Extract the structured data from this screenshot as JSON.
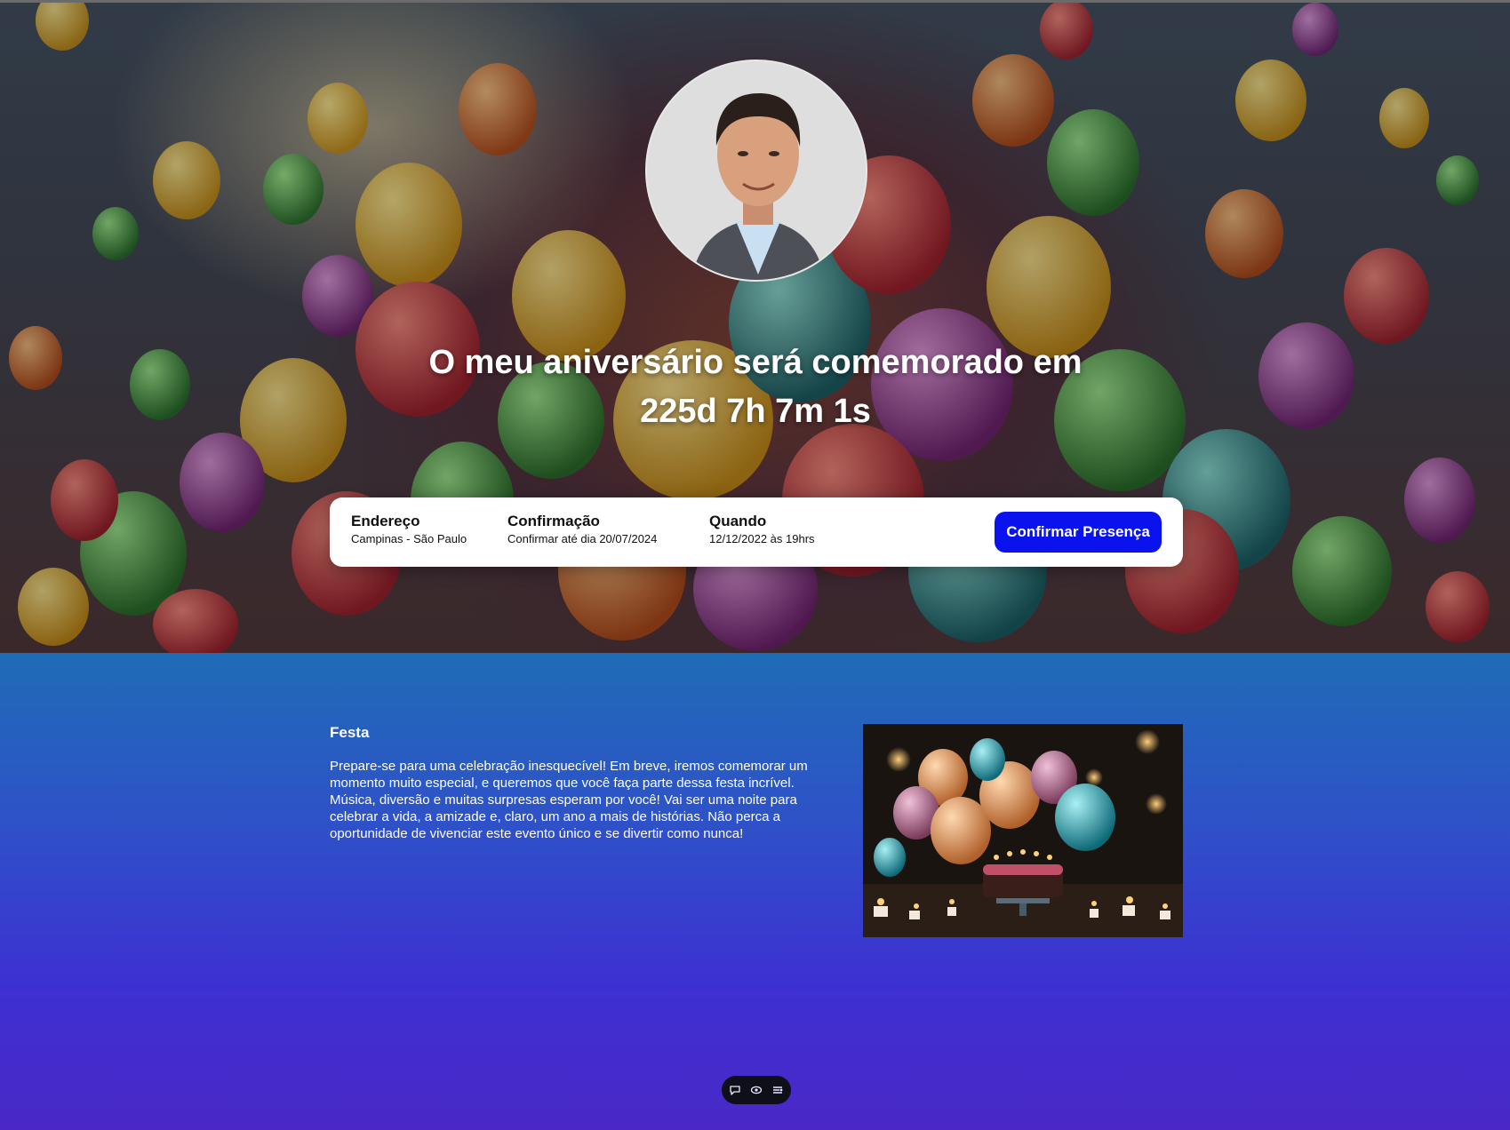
{
  "hero": {
    "headline_line1": "O meu aniversário será comemorado em",
    "countdown": "225d 7h 7m 1s",
    "avatar_icon": "person-photo"
  },
  "info": {
    "address_title": "Endereço",
    "address_value": "Campinas - São Paulo",
    "confirmation_title": "Confirmação",
    "confirmation_value": "Confirmar até dia 20/07/2024",
    "when_title": "Quando",
    "when_value": "12/12/2022 às 19hrs",
    "confirm_button": "Confirmar Presença"
  },
  "festa": {
    "title": "Festa",
    "text": "Prepare-se para uma celebração inesquecível! Em breve, iremos comemorar um momento muito especial, e queremos que você faça parte dessa festa incrível. Música, diversão e muitas surpresas esperam por você! Vai ser uma noite para celebrar a vida, a amizade e, claro, um ano a mais de histórias. Não perca a oportunidade de vivenciar este evento único e se divertir como nunca!",
    "image_icon": "birthday-cake-balloons-photo"
  },
  "toolbar": {
    "icons": [
      "chat-icon",
      "eye-icon",
      "list-settings-icon"
    ]
  },
  "colors": {
    "button_bg": "#0a12ee",
    "lower_gradient_top": "#1f6cb6",
    "lower_gradient_bottom": "#4a28c7"
  }
}
